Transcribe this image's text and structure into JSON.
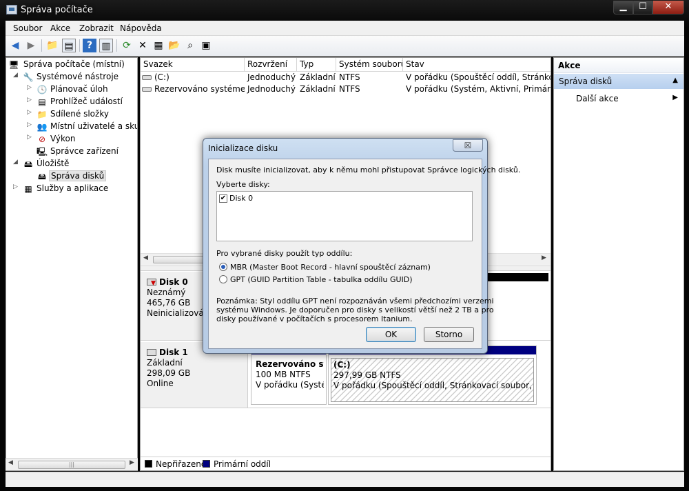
{
  "window": {
    "title": "Správa počítače"
  },
  "menu": [
    "Soubor",
    "Akce",
    "Zobrazit",
    "Nápověda"
  ],
  "toolbar": {
    "icons": [
      "back-arrow-icon",
      "forward-arrow-icon",
      "up-folder-icon",
      "show-hide-tree-icon",
      "help-icon",
      "show-hide-action-pane-icon",
      "refresh-icon",
      "delete-icon",
      "properties-icon",
      "open-icon",
      "search-icon",
      "export-icon"
    ]
  },
  "tree": {
    "root": "Správa počítače (místní)",
    "items": [
      {
        "label": "Systémové nástroje",
        "level": 1,
        "expanded": true
      },
      {
        "label": "Plánovač úloh",
        "level": 2
      },
      {
        "label": "Prohlížeč událostí",
        "level": 2
      },
      {
        "label": "Sdílené složky",
        "level": 2
      },
      {
        "label": "Místní uživatelé a skupiny",
        "level": 2
      },
      {
        "label": "Výkon",
        "level": 2
      },
      {
        "label": "Správce zařízení",
        "level": 2
      },
      {
        "label": "Úložiště",
        "level": 1,
        "expanded": true
      },
      {
        "label": "Správa disků",
        "level": 2,
        "selected": true
      },
      {
        "label": "Služby a aplikace",
        "level": 1
      }
    ]
  },
  "volumes": {
    "columns": [
      "Svazek",
      "Rozvržení",
      "Typ",
      "Systém souborů",
      "Stav"
    ],
    "rows": [
      [
        "(C:)",
        "Jednoduchý",
        "Základní",
        "NTFS",
        "V pořádku (Spouštěcí oddíl, Stránkovací"
      ],
      [
        "Rezervováno systémem",
        "Jednoduchý",
        "Základní",
        "NTFS",
        "V pořádku (Systém, Aktivní, Primární od"
      ]
    ]
  },
  "disks": {
    "disk0": {
      "name": "Disk 0",
      "type": "Neznámý",
      "size": "465,76 GB",
      "status": "Neinicializováno"
    },
    "disk1": {
      "name": "Disk 1",
      "type": "Základní",
      "size": "298,09 GB",
      "status": "Online",
      "partitions": [
        {
          "name": "Rezervováno systémem",
          "size": "100 MB NTFS",
          "status": "V pořádku (Systém"
        },
        {
          "name": "(C:)",
          "size": "297,99 GB NTFS",
          "status": "V pořádku (Spouštěcí oddíl, Stránkovací soubor, Stav sy"
        }
      ]
    }
  },
  "legend": [
    {
      "label": "Nepřiřazeno",
      "color": "#000000"
    },
    {
      "label": "Primární oddíl",
      "color": "#000080"
    }
  ],
  "actions": {
    "title": "Akce",
    "section": "Správa disků",
    "more": "Další akce"
  },
  "dialog": {
    "title": "Inicializace disku",
    "close_glyph": "☒",
    "intro": "Disk musíte inicializovat, aby k němu mohl přistupovat Správce logických disků.",
    "select_label": "Vyberte disky:",
    "disks": [
      {
        "label": "Disk 0",
        "checked": true
      }
    ],
    "partition_style_label": "Pro vybrané disky použít typ oddílu:",
    "options": [
      {
        "label": "MBR (Master Boot Record - hlavní spouštěcí záznam)",
        "selected": true
      },
      {
        "label": "GPT (GUID Partition Table - tabulka oddílu GUID)",
        "selected": false
      }
    ],
    "note_lines": [
      "Poznámka: Styl oddílu GPT není rozpoznáván všemi předchozími verzemi",
      "systému Windows. Je doporučen pro disky s velikostí větší než 2 TB a pro",
      "disky používané v počítačích s procesorem Itanium."
    ],
    "ok_label": "OK",
    "cancel_label": "Storno"
  },
  "colors": {
    "selection": "#cfe0f5",
    "dialog_frame": "#b9cde6",
    "primary_partition": "#000080"
  }
}
